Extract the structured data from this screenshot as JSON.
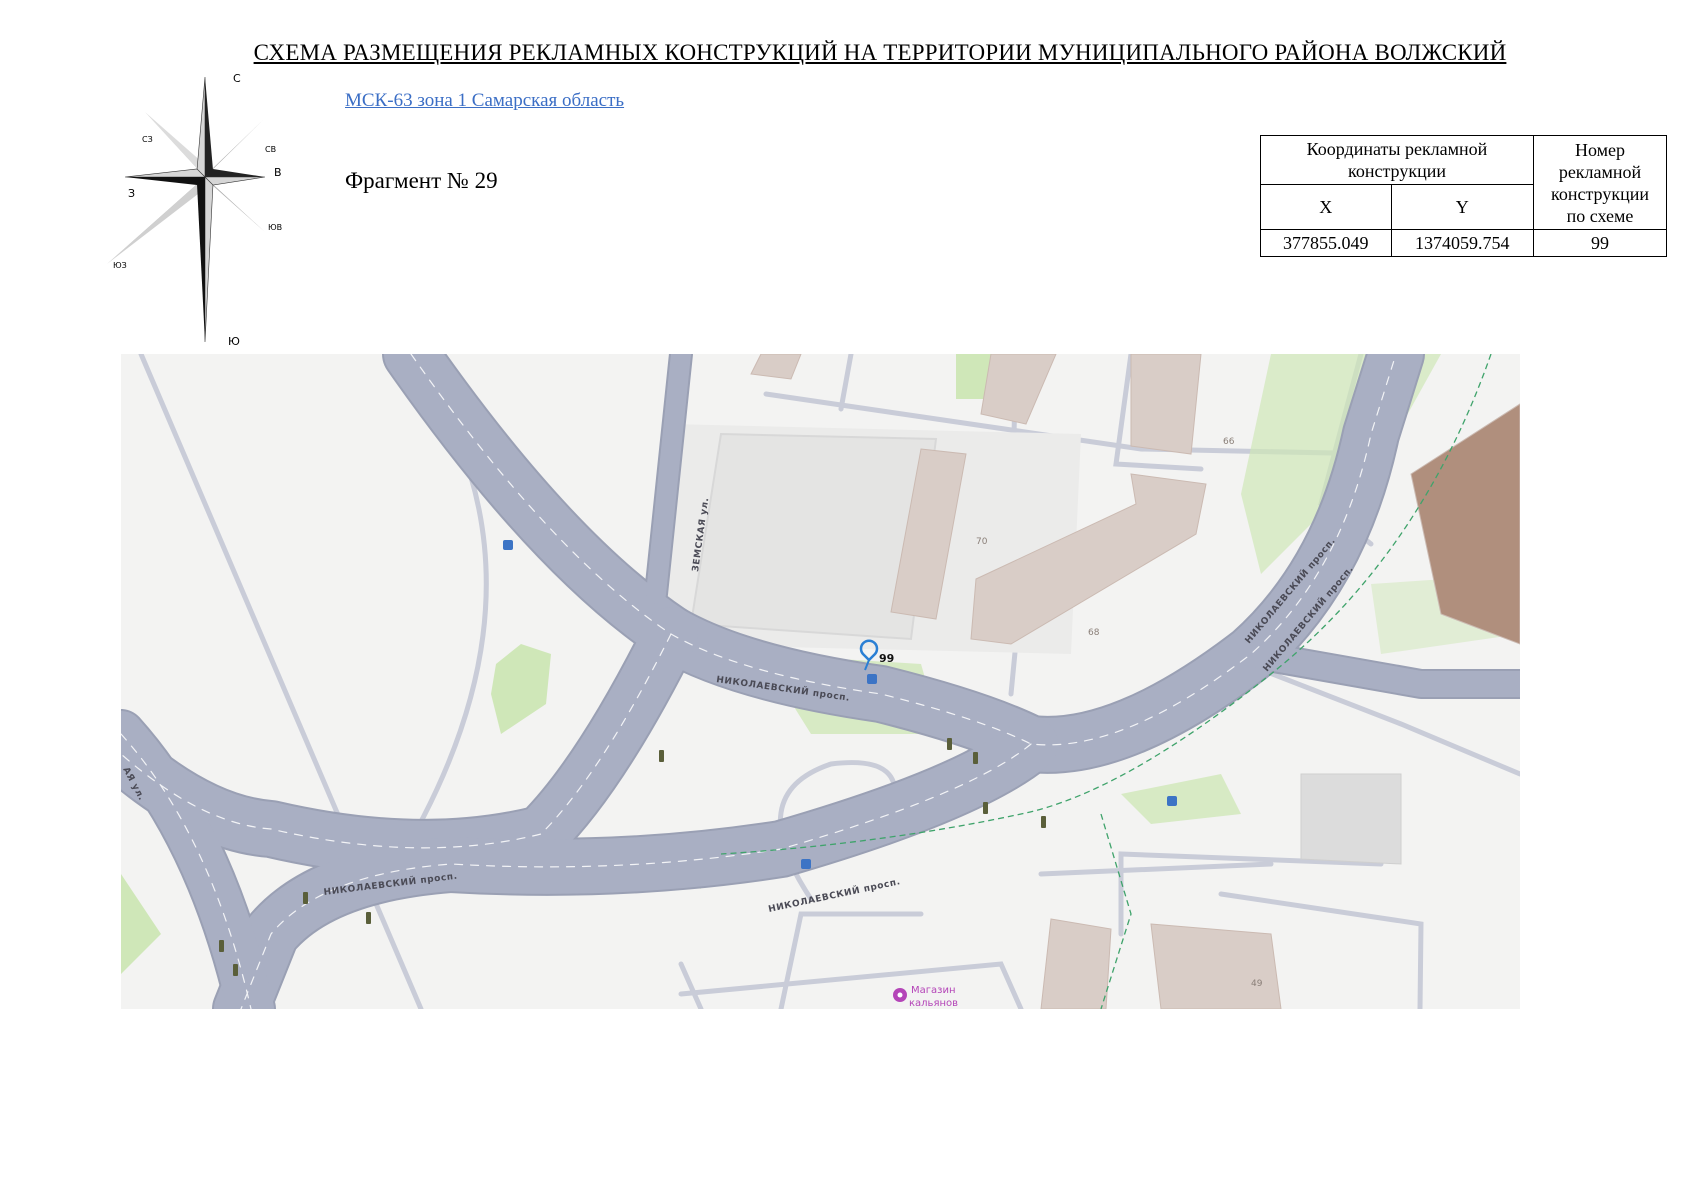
{
  "header": {
    "title": "СХЕМА РАЗМЕЩЕНИЯ РЕКЛАМНЫХ КОНСТРУКЦИЙ НА ТЕРРИТОРИИ МУНИЦИПАЛЬНОГО РАЙОНА ВОЛЖСКИЙ",
    "crs_link": "МСК-63 зона 1 Самарская область",
    "fragment": "Фрагмент № 29"
  },
  "compass": {
    "n": "С",
    "ne": "СВ",
    "e": "В",
    "se": "ЮВ",
    "s": "Ю",
    "sw": "ЮЗ",
    "w": "З",
    "nw": "СЗ"
  },
  "coords_table": {
    "header_coords": "Координаты рекламной конструкции",
    "header_number": "Номер рекламной конструкции по схеме",
    "col_x": "X",
    "col_y": "Y",
    "rows": [
      {
        "x": "377855.049",
        "y": "1374059.754",
        "number": "99"
      }
    ]
  },
  "map": {
    "marker_label": "99",
    "streets": {
      "nikolaevsky_1": "НИКОЛАЕВСКИЙ просп.",
      "nikolaevsky_2": "НИКОЛАЕВСКИЙ просп.",
      "nikolaevsky_3": "НИКОЛАЕВСКИЙ просп.",
      "nikolaevsky_4": "НИКОЛАЕВСКИЙ просп.",
      "nikolaevsky_5": "НИКОЛАЕВСКИЙ просп.",
      "zemskaya": "ЗЕМСКАЯ ул.",
      "edge_street": "АЯ ул."
    },
    "house_numbers": {
      "h70": "70",
      "h68": "68",
      "h66": "66",
      "h49": "49"
    },
    "poi": {
      "line1": "Магазин",
      "line2": "кальянов"
    },
    "colors": {
      "road": "#a9afc3",
      "road_edge": "#9aa0b4",
      "ground": "#f3f3f2",
      "green": "#cfe7b8",
      "building": "#d9cdc7",
      "marker": "#2a7fd4",
      "poi": "#b445b8"
    }
  }
}
